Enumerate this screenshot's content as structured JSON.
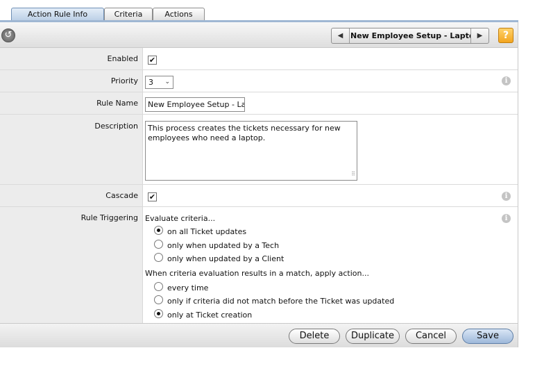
{
  "tabs": [
    {
      "label": "Action Rule Info",
      "active": true
    },
    {
      "label": "Criteria",
      "active": false
    },
    {
      "label": "Actions",
      "active": false
    }
  ],
  "toolbar": {
    "back_icon": "back-circle-arrow-icon",
    "prev_icon": "◀",
    "next_icon": "▶",
    "record_title": "New Employee Setup - Laptop",
    "help_label": "?"
  },
  "fields": {
    "enabled": {
      "label": "Enabled",
      "checked": true,
      "mark": "✔"
    },
    "priority": {
      "label": "Priority",
      "value": "3",
      "chevron": "⌄"
    },
    "rule_name": {
      "label": "Rule Name",
      "value": "New Employee Setup - Laptop"
    },
    "description": {
      "label": "Description",
      "value": "This process creates the tickets necessary for new employees who need a laptop.",
      "grip": "⠿"
    },
    "cascade": {
      "label": "Cascade",
      "checked": true,
      "mark": "✔"
    },
    "rule_triggering": {
      "label": "Rule Triggering",
      "evaluate_heading": "Evaluate criteria...",
      "evaluate_options": [
        {
          "label": "on all Ticket updates",
          "checked": true
        },
        {
          "label": "only when updated by a Tech",
          "checked": false
        },
        {
          "label": "only when updated by a Client",
          "checked": false
        }
      ],
      "apply_heading": "When criteria evaluation results in a match, apply action...",
      "apply_options": [
        {
          "label": "every time",
          "checked": false
        },
        {
          "label": "only if criteria did not match before the Ticket was updated",
          "checked": false
        },
        {
          "label": "only at Ticket creation",
          "checked": true
        }
      ]
    }
  },
  "info_glyph": "i",
  "footer": {
    "delete_label": "Delete",
    "duplicate_label": "Duplicate",
    "cancel_label": "Cancel",
    "save_label": "Save"
  }
}
